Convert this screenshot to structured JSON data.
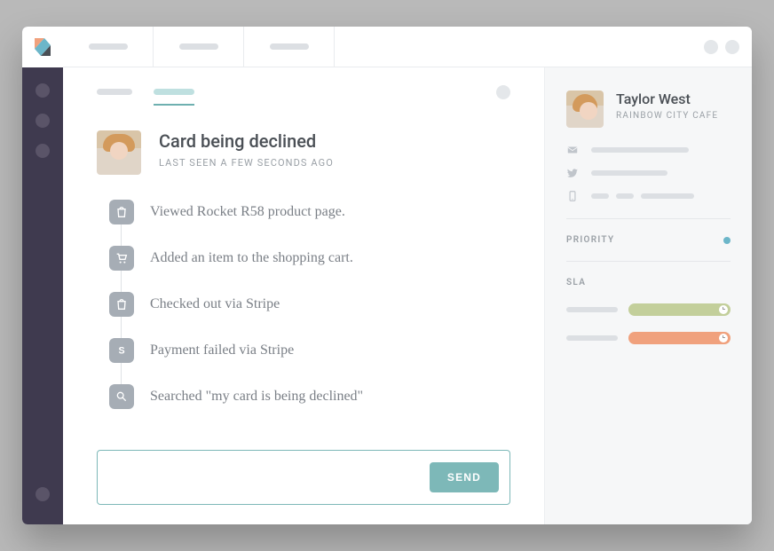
{
  "ticket": {
    "title": "Card being declined",
    "subtitle": "LAST SEEN A FEW SECONDS AGO",
    "timeline": [
      {
        "icon": "shop-bag",
        "text": "Viewed Rocket R58 product page."
      },
      {
        "icon": "cart",
        "text": "Added an item to the shopping cart."
      },
      {
        "icon": "shop-bag",
        "text": "Checked out via Stripe"
      },
      {
        "icon": "stripe",
        "text": "Payment failed via Stripe"
      },
      {
        "icon": "search",
        "text": "Searched \"my card is being declined\""
      }
    ],
    "send_label": "SEND",
    "reply_placeholder": ""
  },
  "customer": {
    "name": "Taylor West",
    "company": "RAINBOW CITY CAFE"
  },
  "sections": {
    "priority_label": "PRIORITY",
    "sla_label": "SLA"
  }
}
